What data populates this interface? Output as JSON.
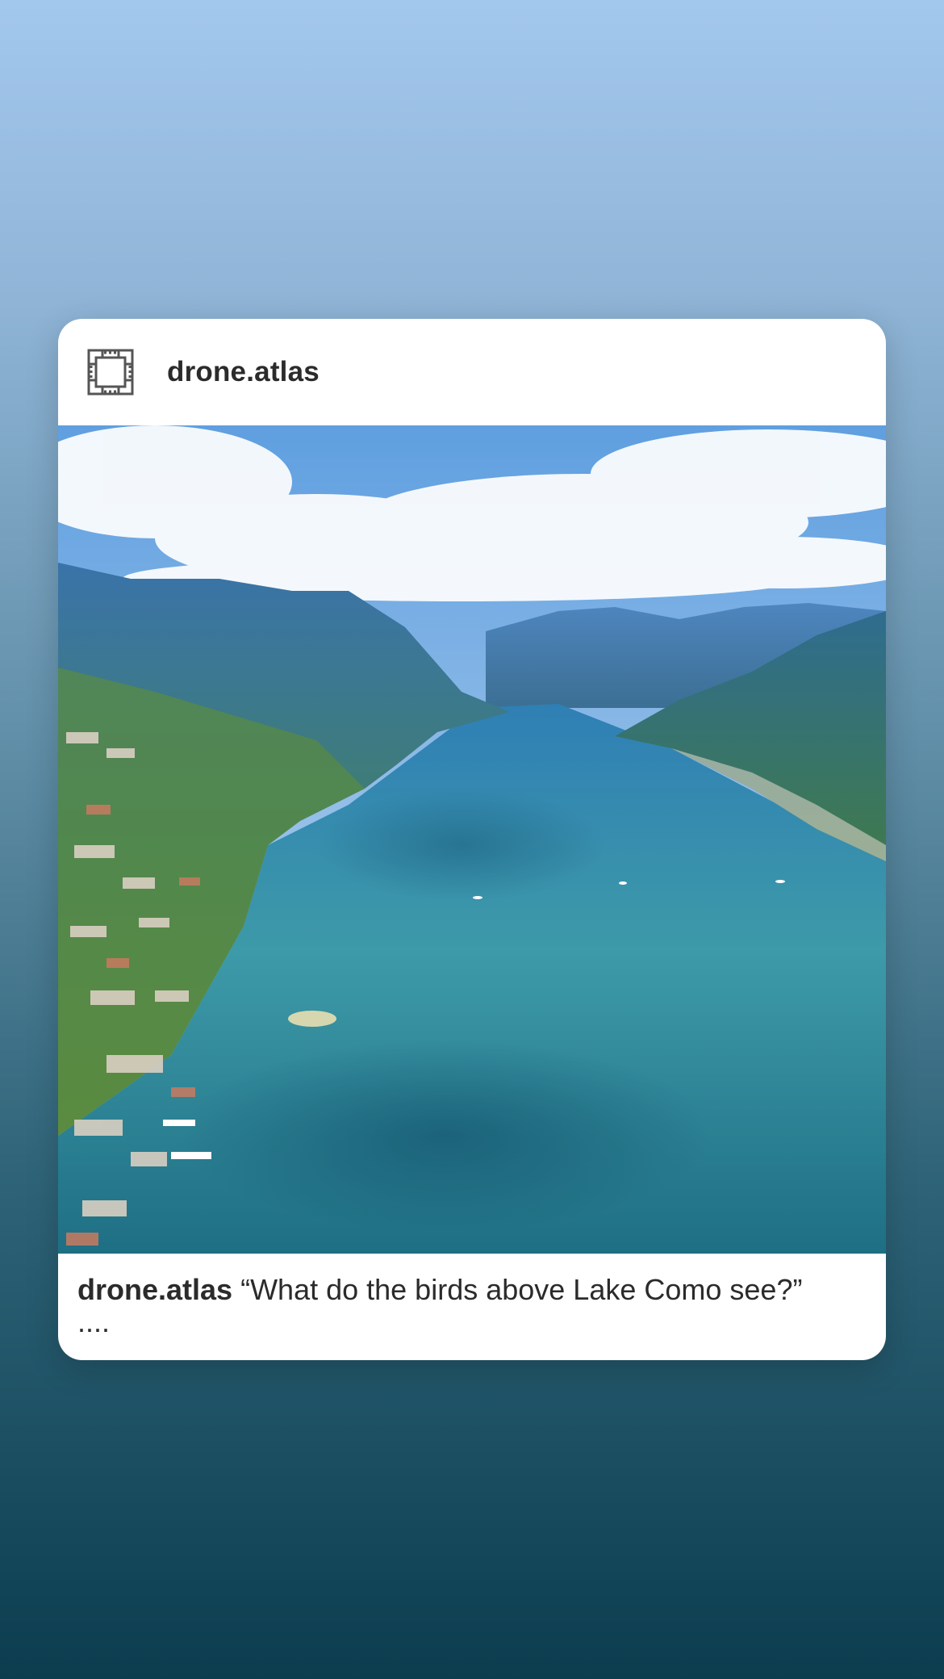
{
  "post": {
    "username": "drone.atlas",
    "avatar_icon": "ornamental-frame-logo-icon",
    "photo_description_icon": "lake-photo",
    "caption": {
      "username": "drone.atlas",
      "text": "“What do the birds above Lake Como see?”",
      "more": "...."
    }
  },
  "colors": {
    "card_background": "#ffffff",
    "text": "#2b2b2b",
    "lake": "#2f8fa0",
    "sky": "#6aa7de"
  }
}
